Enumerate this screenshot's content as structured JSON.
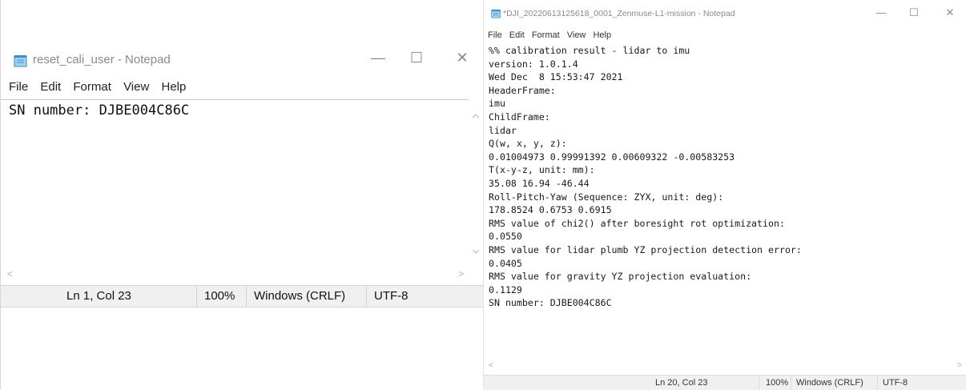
{
  "left_window": {
    "title": "reset_cali_user - Notepad",
    "controls": {
      "minimize": "—",
      "maximize": "☐",
      "close": "✕"
    },
    "menu": [
      "File",
      "Edit",
      "Format",
      "View",
      "Help"
    ],
    "content": "SN number: DJBE004C86C",
    "status": {
      "position": "Ln 1, Col 23",
      "zoom": "100%",
      "line_ending": "Windows (CRLF)",
      "encoding": "UTF-8"
    },
    "scroll_left_arrow": "<",
    "scroll_right_arrow": ">"
  },
  "right_window": {
    "title": "*DJI_20220613125618_0001_Zenmuse-L1-mission - Notepad",
    "controls": {
      "minimize": "—",
      "maximize": "☐",
      "close": "✕"
    },
    "menu": [
      "File",
      "Edit",
      "Format",
      "View",
      "Help"
    ],
    "content": "%% calibration result - lidar to imu\nversion: 1.0.1.4\nWed Dec  8 15:53:47 2021\nHeaderFrame:\nimu\nChildFrame:\nlidar\nQ(w, x, y, z):\n0.01004973 0.99991392 0.00609322 -0.00583253\nT(x-y-z, unit: mm):\n35.08 16.94 -46.44\nRoll-Pitch-Yaw (Sequence: ZYX, unit: deg):\n178.8524 0.6753 0.6915\nRMS value of chi2() after boresight rot optimization:\n0.0550\nRMS value for lidar plumb YZ projection detection error:\n0.0405\nRMS value for gravity YZ projection evaluation:\n0.1129\nSN number: DJBE004C86C",
    "status": {
      "position": "Ln 20, Col 23",
      "zoom": "100%",
      "line_ending": "Windows (CRLF)",
      "encoding": "UTF-8"
    },
    "scroll_left_arrow": "<",
    "scroll_right_arrow": ">"
  },
  "icons": {
    "notepad": "notepad-icon"
  },
  "colors": {
    "titlebar_text": "#8a8a8a",
    "statusbar_bg": "#f0f0f0",
    "icon_blue": "#4aa3df"
  }
}
